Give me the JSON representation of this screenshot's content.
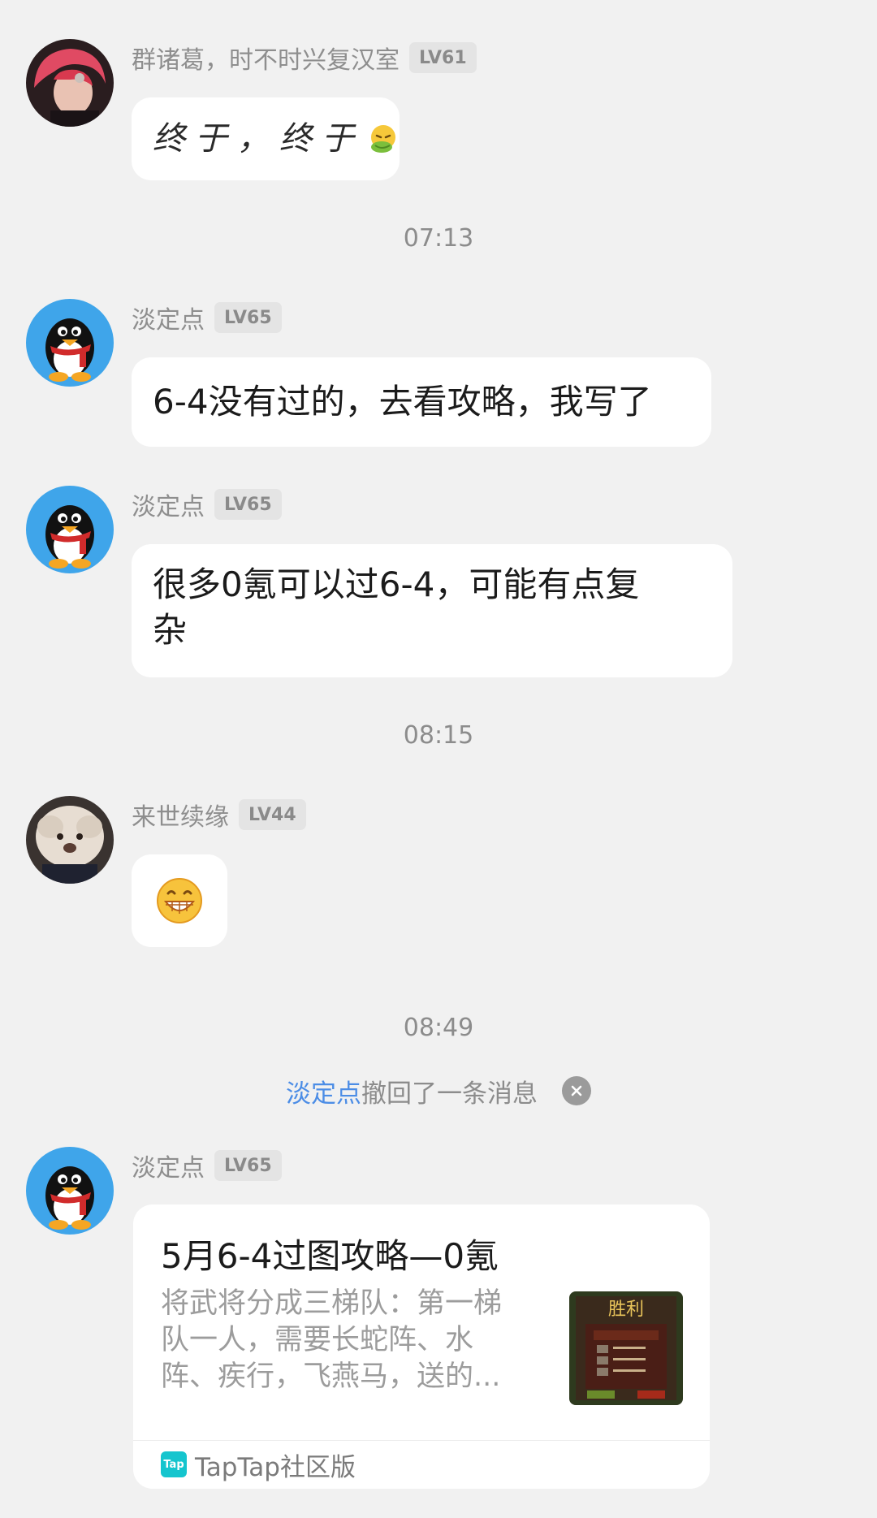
{
  "messages": [
    {
      "sender": "群诸葛，时不时兴复汉室",
      "level": "LV61",
      "text": "终于，终于",
      "emoji": "sick-emoji"
    },
    {
      "sender": "淡定点",
      "level": "LV65",
      "text": "6-4没有过的，去看攻略，我写了"
    },
    {
      "sender": "淡定点",
      "level": "LV65",
      "line1": "很多0氪可以过6-4，可能有点复",
      "line2": "杂"
    },
    {
      "sender": "来世续缘",
      "level": "LV44",
      "emoji": "grin-emoji"
    },
    {
      "sender": "淡定点",
      "level": "LV65"
    }
  ],
  "timestamps": [
    "07:13",
    "08:15",
    "08:49"
  ],
  "recall": {
    "name": "淡定点",
    "text": "撤回了一条消息",
    "close_icon": "close-icon"
  },
  "card": {
    "title": "5月6-4过图攻略—0氪",
    "desc": "将武将分成三梯队：第一梯队一人，需要长蛇阵、水阵、疾行，飞燕马，送的...",
    "thumb_title": "胜利",
    "logo_text": "Tap",
    "source": "TapTap社区版"
  },
  "colors": {
    "background": "#f1f1f1",
    "bubble": "#ffffff",
    "link": "#4c8de6",
    "muted": "#8c8c8c",
    "penguin_bg": "#3fa5ea"
  }
}
